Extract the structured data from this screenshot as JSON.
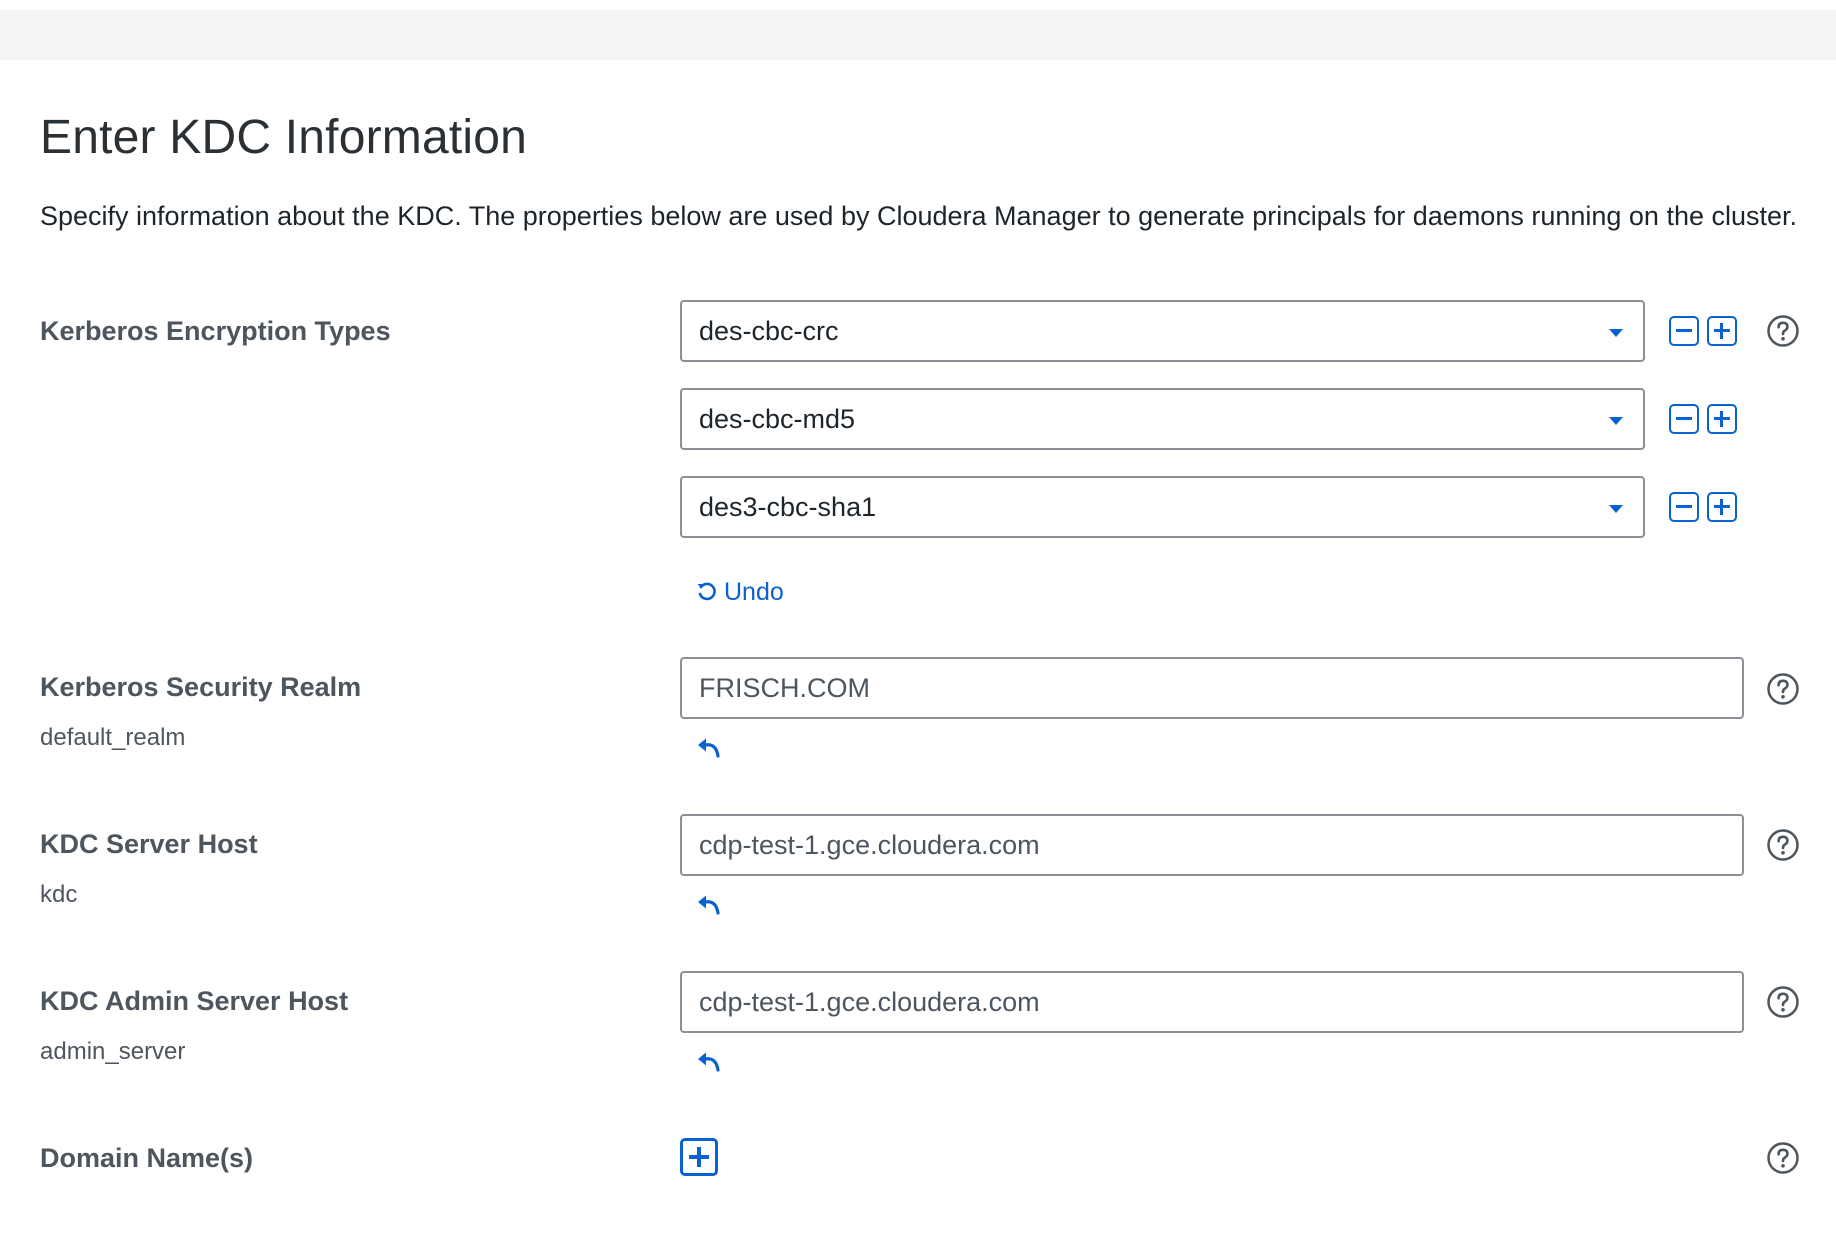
{
  "page": {
    "title": "Enter KDC Information",
    "description": "Specify information about the KDC. The properties below are used by Cloudera Manager to generate principals for daemons running on the cluster."
  },
  "encryption": {
    "label": "Kerberos Encryption Types",
    "values": [
      "des-cbc-crc",
      "des-cbc-md5",
      "des3-cbc-sha1"
    ],
    "undo_label": "Undo"
  },
  "realm": {
    "label": "Kerberos Security Realm",
    "key": "default_realm",
    "value": "FRISCH.COM"
  },
  "kdc_host": {
    "label": "KDC Server Host",
    "key": "kdc",
    "value": "cdp-test-1.gce.cloudera.com"
  },
  "admin_host": {
    "label": "KDC Admin Server Host",
    "key": "admin_server",
    "value": "cdp-test-1.gce.cloudera.com"
  },
  "domains": {
    "label": "Domain Name(s)"
  },
  "colors": {
    "accent": "#0a62d0",
    "label_text": "#4d565e",
    "border": "#8a9095",
    "top_bar": "#f3f4f6"
  },
  "icons": [
    "caret-down-icon",
    "minus-square-icon",
    "plus-square-icon",
    "help-circle-icon",
    "undo-icon",
    "revert-arrow-icon"
  ]
}
